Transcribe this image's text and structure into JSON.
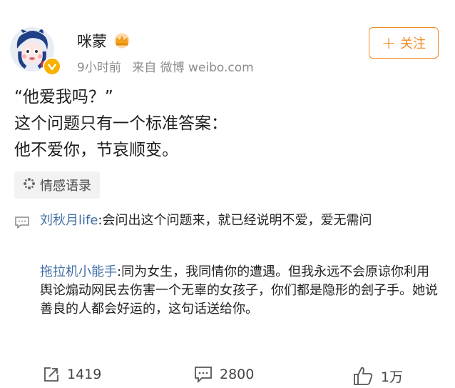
{
  "post": {
    "username": "咪蒙",
    "time": "9小时前",
    "source": "来自 微博 weibo.com",
    "follow_label": "关注",
    "lines": [
      "“他爱我吗？”",
      "这个问题只有一个标准答案：",
      "他不爱你，节哀顺变。"
    ],
    "tag": "情感语录"
  },
  "comments": [
    {
      "user": "刘秋月life",
      "text": ":会问出这个问题来，就已经说明不爱，爱无需问"
    },
    {
      "user": "拖拉机小能手",
      "text": ":同为女生，我同情你的遭遇。但我永远不会原谅你利用舆论煽动网民去伤害一个无辜的女孩子，你们都是隐形的刽子手。她说善良的人都会好运的，这句话送给你。"
    }
  ],
  "actions": {
    "repost_count": "1419",
    "comment_count": "2800",
    "like_count": "1万"
  },
  "colors": {
    "accent": "#f28a24",
    "link": "#436ea6",
    "muted": "#8c8c8c"
  },
  "icons": [
    "avatar",
    "verified-v-icon",
    "crown-icon",
    "plus-icon",
    "sparkle-icon",
    "comment-icon",
    "repost-icon",
    "like-icon"
  ]
}
